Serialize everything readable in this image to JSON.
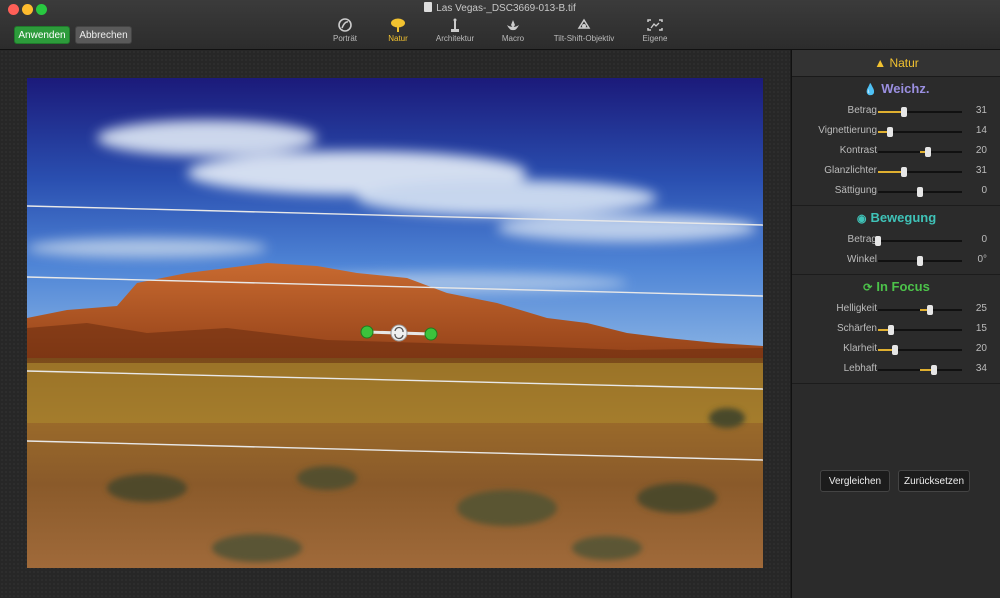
{
  "window": {
    "title": "Las Vegas-_DSC3669-013-B.tif"
  },
  "toolbar": {
    "apply_label": "Anwenden",
    "cancel_label": "Abbrechen",
    "tabs": [
      {
        "label": "Porträt",
        "icon": "portrait-icon"
      },
      {
        "label": "Natur",
        "icon": "tree-icon"
      },
      {
        "label": "Architektur",
        "icon": "statue-icon"
      },
      {
        "label": "Macro",
        "icon": "flower-icon"
      },
      {
        "label": "Tilt-Shift-Objektiv",
        "icon": "tilt-shift-icon"
      },
      {
        "label": "Eigene",
        "icon": "custom-frame-icon"
      }
    ],
    "active_tab": "Natur"
  },
  "panel": {
    "title": "Natur",
    "sections": [
      {
        "title": "Weichz.",
        "color": "#9a8fe0",
        "rows": [
          {
            "label": "Betrag",
            "value": "31",
            "level": 0.31
          },
          {
            "label": "Vignettierung",
            "value": "14",
            "level": 0.14
          },
          {
            "label": "Kontrast",
            "value": "20",
            "level": 0.6,
            "center_fill": true
          },
          {
            "label": "Glanzlichter",
            "value": "31",
            "level": 0.31
          },
          {
            "label": "Sättigung",
            "value": "0",
            "level": 0.5,
            "center_fill": true
          }
        ]
      },
      {
        "title": "Bewegung",
        "color": "#3fc3b8",
        "rows": [
          {
            "label": "Betrag",
            "value": "0",
            "level": 0.0
          },
          {
            "label": "Winkel",
            "value": "0°",
            "level": 0.5,
            "center_fill": true
          }
        ]
      },
      {
        "title": "In Focus",
        "color": "#4cc24a",
        "rows": [
          {
            "label": "Helligkeit",
            "value": "25",
            "level": 0.62,
            "center_fill": true
          },
          {
            "label": "Schärfen",
            "value": "15",
            "level": 0.15
          },
          {
            "label": "Klarheit",
            "value": "20",
            "level": 0.2
          },
          {
            "label": "Lebhaft",
            "value": "34",
            "level": 0.67,
            "center_fill": true
          }
        ]
      }
    ],
    "compare_label": "Vergleichen",
    "reset_label": "Zurücksetzen"
  }
}
